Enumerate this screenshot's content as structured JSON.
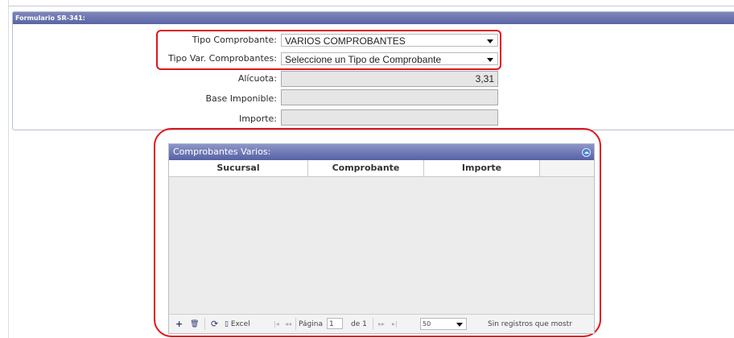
{
  "form": {
    "title": "Formulario SR-341:",
    "tipo_comprobante": {
      "label": "Tipo Comprobante:",
      "value": "VARIOS COMPROBANTES"
    },
    "tipo_var": {
      "label": "Tipo Var. Comprobantes:",
      "value": "Seleccione un Tipo de Comprobante"
    },
    "alicuota": {
      "label": "Alícuota:",
      "value": "3,31"
    },
    "base_imponible": {
      "label": "Base Imponible:",
      "value": ""
    },
    "importe": {
      "label": "Importe:",
      "value": ""
    }
  },
  "grid": {
    "caption": "Comprobantes Varios:",
    "columns": [
      "Sucursal",
      "Comprobante",
      "Importe"
    ],
    "rows": [],
    "pager": {
      "add_icon": "+",
      "delete_icon": "🗑",
      "refresh_icon": "⟳",
      "excel_label": "Excel",
      "pagina_label": "Página",
      "page_value": "1",
      "de_label": "de 1",
      "rows_per_page": "50",
      "status": "Sin registros que mostr"
    }
  },
  "colors": {
    "accent": "#5964a3",
    "highlight": "#e0151d"
  }
}
